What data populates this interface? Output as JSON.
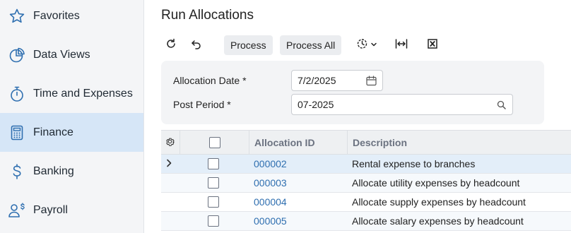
{
  "sidebar": {
    "items": [
      {
        "label": "Favorites",
        "icon": "star-icon"
      },
      {
        "label": "Data Views",
        "icon": "pie-chart-icon"
      },
      {
        "label": "Time and Expenses",
        "icon": "stopwatch-icon"
      },
      {
        "label": "Finance",
        "icon": "calculator-icon",
        "active": true
      },
      {
        "label": "Banking",
        "icon": "dollar-icon"
      },
      {
        "label": "Payroll",
        "icon": "user-dollar-icon"
      }
    ]
  },
  "page": {
    "title": "Run Allocations"
  },
  "toolbar": {
    "process_label": "Process",
    "process_all_label": "Process All"
  },
  "form": {
    "allocation_date_label": "Allocation Date",
    "allocation_date_value": "7/2/2025",
    "post_period_label": "Post Period",
    "post_period_value": "07-2025",
    "required_mark": "*"
  },
  "grid": {
    "columns": [
      "Allocation ID",
      "Description"
    ],
    "rows": [
      {
        "id": "000002",
        "description": "Rental expense to branches"
      },
      {
        "id": "000003",
        "description": "Allocate utility expenses by headcount"
      },
      {
        "id": "000004",
        "description": "Allocate supply expenses by headcount"
      },
      {
        "id": "000005",
        "description": "Allocate salary expenses by headcount"
      }
    ]
  },
  "colors": {
    "accent": "#2f6fb0",
    "sidebar_active": "#d6e6f7",
    "icon_blue": "#2f6fb0"
  }
}
